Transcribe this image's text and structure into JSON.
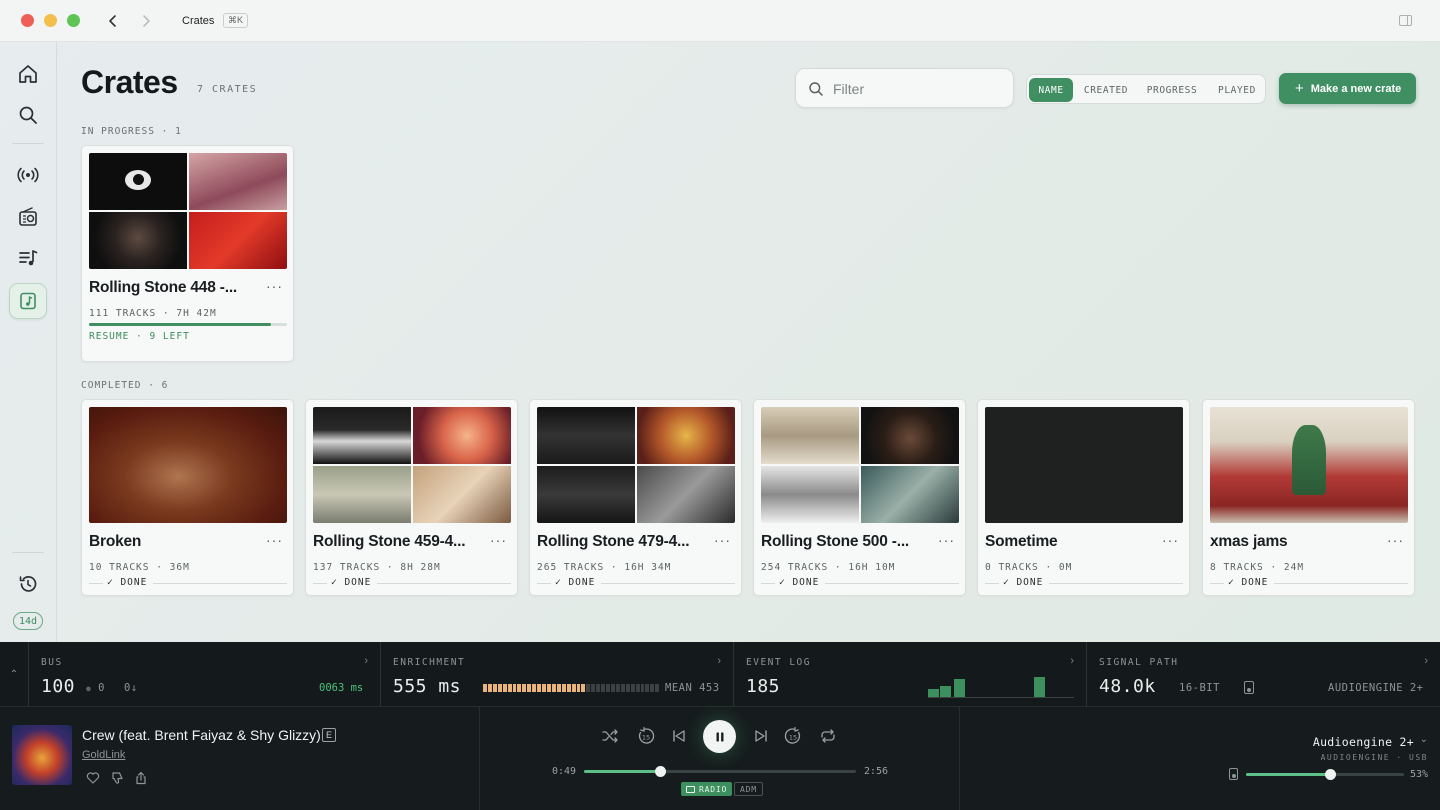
{
  "window": {
    "title": "Crates",
    "shortcut": "⌘K"
  },
  "sidebar": {
    "items": [
      {
        "name": "home-icon",
        "active": false
      },
      {
        "name": "search-icon",
        "active": false
      },
      {
        "name": "broadcast-icon",
        "active": false
      },
      {
        "name": "radio-icon",
        "active": false
      },
      {
        "name": "playlist-icon",
        "active": false
      },
      {
        "name": "crate-icon",
        "active": true
      }
    ],
    "history_icon": "history-icon",
    "badge": "14d"
  },
  "header": {
    "title": "Crates",
    "count": "7 CRATES",
    "filter_placeholder": "Filter",
    "sort": [
      "NAME",
      "CREATED",
      "PROGRESS",
      "PLAYED"
    ],
    "sort_active": "NAME",
    "new_button": "Make a new crate"
  },
  "sections": {
    "in_progress": {
      "label": "IN PROGRESS · 1",
      "crates": [
        {
          "name": "Rolling Stone 448 -...",
          "meta": "111 TRACKS · 7H 42M",
          "progress": 0.92,
          "status": "RESUME · 9 LEFT"
        }
      ]
    },
    "completed": {
      "label": "COMPLETED · 6",
      "crates": [
        {
          "name": "Broken",
          "meta": "10 TRACKS · 36M",
          "status": "✓ DONE"
        },
        {
          "name": "Rolling Stone 459-4...",
          "meta": "137 TRACKS · 8H 28M",
          "status": "✓ DONE"
        },
        {
          "name": "Rolling Stone 479-4...",
          "meta": "265 TRACKS · 16H 34M",
          "status": "✓ DONE"
        },
        {
          "name": "Rolling Stone 500 -...",
          "meta": "254 TRACKS · 16H 10M",
          "status": "✓ DONE"
        },
        {
          "name": "Sometime",
          "meta": "0 TRACKS · 0M",
          "status": "✓ DONE"
        },
        {
          "name": "xmas jams",
          "meta": "8 TRACKS · 24M",
          "status": "✓ DONE"
        }
      ]
    }
  },
  "stats": {
    "bus": {
      "label": "BUS",
      "value": "100",
      "sub1": "0",
      "sub2": "0↓",
      "latency": "0063 ms"
    },
    "enrichment": {
      "label": "ENRICHMENT",
      "value": "555 ms",
      "mean": "MEAN 453",
      "meter_level": 0.57
    },
    "event_log": {
      "label": "EVENT LOG",
      "value": "185",
      "bars": [
        0.35,
        0.45,
        0.75,
        0.1,
        0.85
      ]
    },
    "signal_path": {
      "label": "SIGNAL PATH",
      "value": "48.0k",
      "depth": "16-BIT",
      "device": "AUDIOENGINE 2+"
    }
  },
  "player": {
    "track": "Crew (feat. Brent Faiyaz & Shy Glizzy)",
    "explicit": "E",
    "artist": "GoldLink",
    "elapsed": "0:49",
    "duration": "2:56",
    "progress": 0.28,
    "chip_radio": "RADIO",
    "chip_adm": "ADM",
    "device_name": "Audioengine 2+",
    "device_sub": "AUDIOENGINE · USB",
    "volume": 0.53,
    "volume_label": "53%"
  },
  "colors": {
    "accent": "#3f8f63",
    "dark_bg": "#141a1b",
    "page_bg": "#e5ece9"
  }
}
